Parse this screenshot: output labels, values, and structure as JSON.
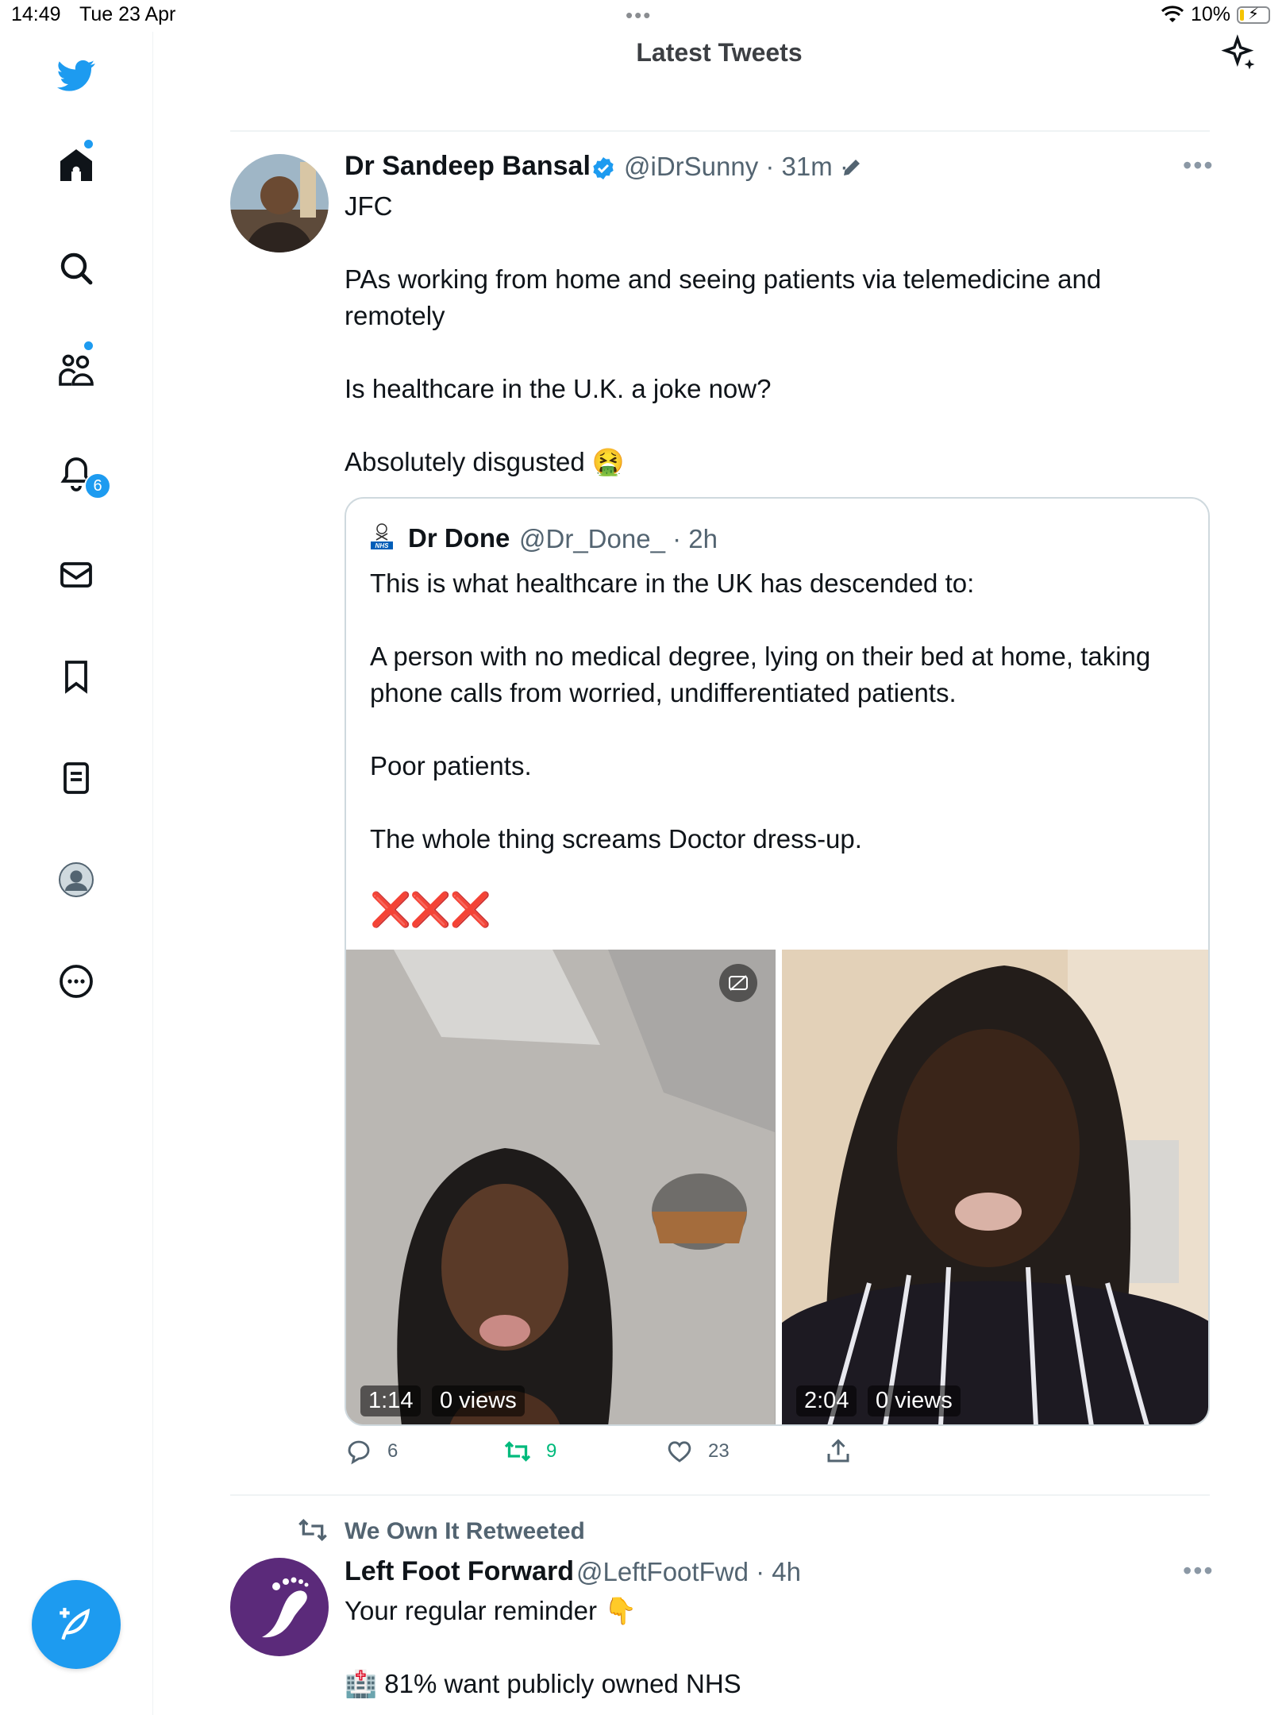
{
  "status_bar": {
    "time": "14:49",
    "date": "Tue 23 Apr",
    "battery": "10%"
  },
  "header": {
    "title": "Latest Tweets"
  },
  "sidebar": {
    "notifications_count": "6"
  },
  "tweet1": {
    "name": "Dr Sandeep Bansal",
    "handle": "@iDrSunny · 31m ·",
    "text": "JFC\n\nPAs working from home and seeing patients via telemedicine and\nremotely\n\nIs healthcare in the U.K. a joke now?\n\nAbsolutely disgusted 🤮",
    "quote": {
      "name": "Dr Done",
      "handle": "@Dr_Done_ · 2h",
      "text": "This is what healthcare in the UK has descended to:\n\nA person with no medical degree, lying on their bed at home, taking\nphone calls from worried, undifferentiated patients.\n\nPoor patients.\n\nThe whole thing screams Doctor dress-up.",
      "marks": "❌❌❌",
      "videos": [
        {
          "duration": "1:14",
          "views": "0 views"
        },
        {
          "duration": "2:04",
          "views": "0 views"
        }
      ]
    },
    "replies": "6",
    "retweets": "9",
    "likes": "23"
  },
  "tweet2": {
    "retweeted_by": "We Own It Retweeted",
    "name": "Left Foot Forward",
    "handle": "@LeftFootFwd · 4h",
    "line1": "Your regular reminder 👇",
    "line2": "🏥 81% want publicly owned NHS"
  },
  "colors": {
    "accent": "#1d9bf0",
    "retweet": "#00ba7c",
    "red_x": "#e0000f"
  }
}
